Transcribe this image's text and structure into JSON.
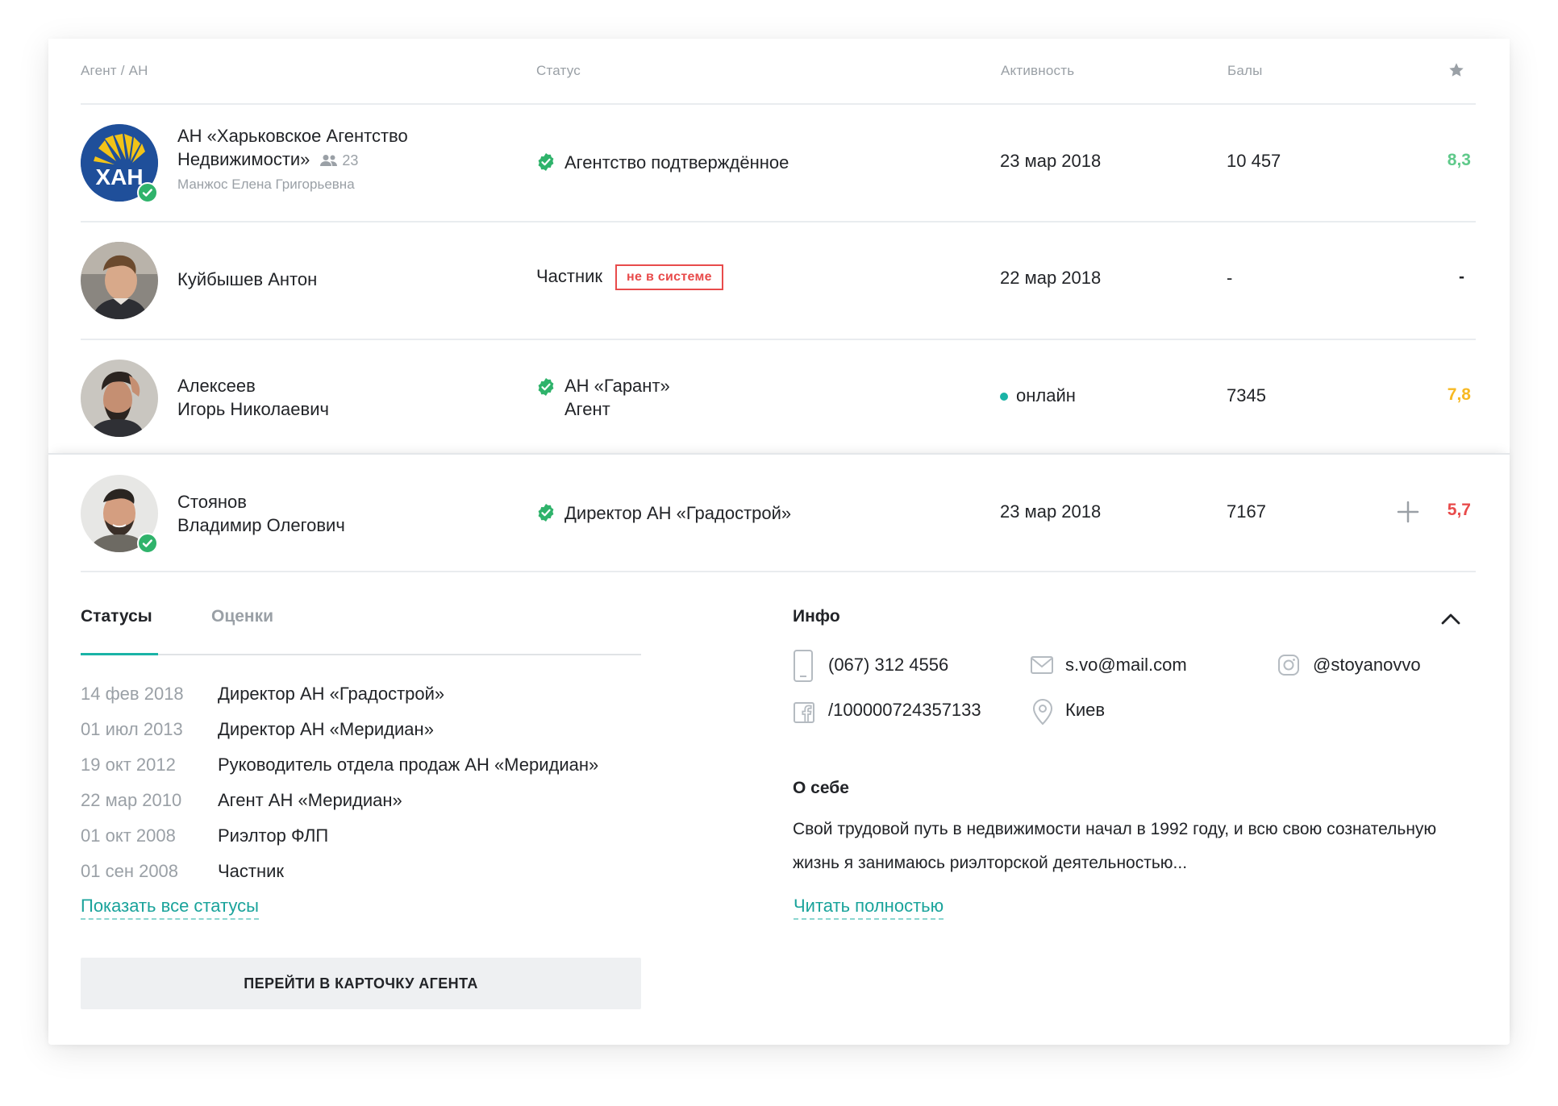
{
  "header": {
    "col_agent": "Агент / АН",
    "col_status": "Статус",
    "col_activity": "Активность",
    "col_points": "Балы"
  },
  "rows": [
    {
      "name_line1": "АН «Харьковское Агентство",
      "name_line2": "Недвижимости»",
      "members": "23",
      "sub": "Манжос Елена Григорьевна",
      "status": "Агентство подтверждённое",
      "activity": "23 мар 2018",
      "points": "10 457",
      "rating": "8,3",
      "rating_color": "#5fc98a",
      "logo_text": "ХАН"
    },
    {
      "name_line1": "Куйбышев Антон",
      "status": "Частник",
      "badge": "не в системе",
      "activity": "22 мар 2018",
      "points": "-",
      "rating": "-"
    },
    {
      "name_line1": "Алексеев",
      "name_line2": "Игорь Николаевич",
      "status_line1": "АН «Гарант»",
      "status_line2": "Агент",
      "activity": "онлайн",
      "points": "7345",
      "rating": "7,8",
      "rating_color": "#f7b924"
    },
    {
      "name_line1": "Стоянов",
      "name_line2": "Владимир Олегович",
      "status": "Директор АН «Градострой»",
      "activity": "23 мар 2018",
      "points": "7167",
      "rating": "5,7",
      "rating_color": "#e84b4b"
    }
  ],
  "tabs": {
    "statuses": "Статусы",
    "ratings": "Оценки"
  },
  "history": [
    {
      "date": "14 фев 2018",
      "text": "Директор АН «Градострой»"
    },
    {
      "date": "01 июл 2013",
      "text": "Директор АН «Меридиан»"
    },
    {
      "date": "19 окт 2012",
      "text": "Руководитель отдела продаж  АН «Меридиан»"
    },
    {
      "date": "22 мар 2010",
      "text": "Агент АН «Меридиан»"
    },
    {
      "date": "01 окт 2008",
      "text": "Риэлтор ФЛП"
    },
    {
      "date": "01 сен 2008",
      "text": "Частник"
    }
  ],
  "show_all_link": "Показать все статусы",
  "agent_card_button": "ПЕРЕЙТИ В КАРТОЧКУ АГЕНТА",
  "info": {
    "title": "Инфо",
    "phone": "(067) 312 4556",
    "email": "s.vo@mail.com",
    "instagram": "@stoyanovvo",
    "facebook": "/100000724357133",
    "city": "Киев",
    "about_title": "О себе",
    "about_text": "Свой трудовой путь в недвижимости начал в 1992 году, и всю свою сознательную жизнь я занимаюсь риэлторской деятельностью...",
    "read_more": "Читать полностью"
  },
  "colors": {
    "accent": "#1ab3a6",
    "verified": "#2fb36b",
    "danger": "#e84b4b"
  }
}
